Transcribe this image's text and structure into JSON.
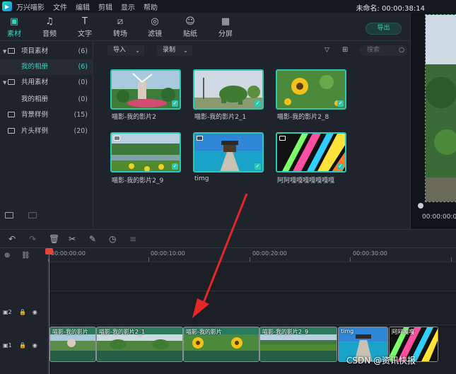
{
  "menubar": {
    "app_name": "万兴喵影",
    "items": [
      "文件",
      "编辑",
      "剪辑",
      "显示",
      "帮助"
    ],
    "project_title": "未命名: 00:00:38:14"
  },
  "toolbar": {
    "tools": [
      {
        "label": "素材",
        "icon": "folder-icon",
        "active": true
      },
      {
        "label": "音频",
        "icon": "music-note-icon",
        "active": false
      },
      {
        "label": "文字",
        "icon": "text-icon",
        "active": false
      },
      {
        "label": "转场",
        "icon": "transition-icon",
        "active": false
      },
      {
        "label": "滤镜",
        "icon": "filter-icon",
        "active": false
      },
      {
        "label": "贴纸",
        "icon": "sticker-icon",
        "active": false
      },
      {
        "label": "分屏",
        "icon": "split-screen-icon",
        "active": false
      }
    ],
    "export_label": "导出"
  },
  "sidebar": {
    "items": [
      {
        "label": "项目素材",
        "count": "(6)"
      },
      {
        "label": "我的相册",
        "count": "(6)"
      },
      {
        "label": "共用素材",
        "count": "(0)"
      },
      {
        "label": "我的相册",
        "count": "(0)"
      },
      {
        "label": "背景样例",
        "count": "(15)"
      },
      {
        "label": "片头样例",
        "count": "(20)"
      }
    ]
  },
  "media": {
    "import_label": "导入",
    "record_label": "录制",
    "search_placeholder": "搜索",
    "items": [
      {
        "label": "喵影-我的影片2"
      },
      {
        "label": "喵影-我的影片2_1"
      },
      {
        "label": "喵影-我的影片2_8"
      },
      {
        "label": "喵影-我的影片2_9"
      },
      {
        "label": "timg"
      },
      {
        "label": "阿阿嘎嘎嘎嘎嘎嘎嘎"
      }
    ]
  },
  "preview": {
    "time": "00:00:00:00"
  },
  "timeline": {
    "ruler": [
      "00:00:00:00",
      "00:00:10:00",
      "00:00:20:00",
      "00:00:30:00"
    ],
    "tracks": [
      "2",
      "1"
    ],
    "clips": [
      {
        "label": "喵影-我的影片"
      },
      {
        "label": "喵影-我的影片2_1"
      },
      {
        "label": "喵影-我的影片"
      },
      {
        "label": "喵影-我的影片2_9"
      },
      {
        "label": "timg"
      },
      {
        "label": "阿阿嘎嘎"
      }
    ]
  },
  "watermark": "CSDN @资讯快报"
}
